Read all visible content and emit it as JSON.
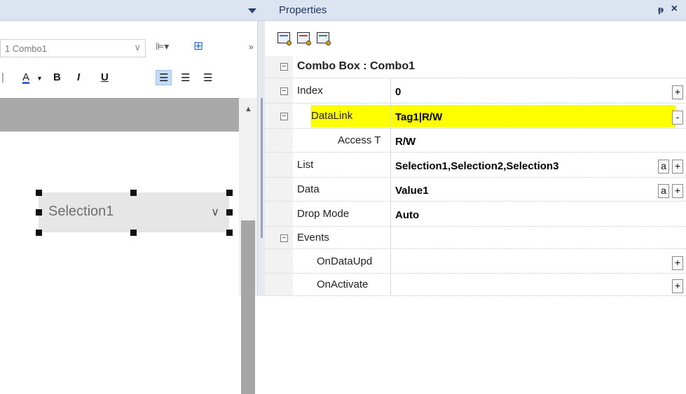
{
  "left": {
    "toolbar": {
      "object_combo_value": "1 Combo1",
      "overflow_label": "»"
    },
    "format_bar": {
      "font_color": "A",
      "bold": "B",
      "italic": "I",
      "underline": "U"
    },
    "widget": {
      "selected_text": "Selection1"
    }
  },
  "properties": {
    "title": "Properties",
    "pin_glyph": "ᵖ",
    "close_glyph": "×",
    "section_title": "Combo Box : Combo1",
    "rows": [
      {
        "name": "Index",
        "value": "0",
        "expander": "−",
        "buttons": [
          "+"
        ]
      },
      {
        "name": "DataLink",
        "value": "Tag1|R/W",
        "expander": "−",
        "buttons": [
          "-"
        ],
        "highlight": "#ffff00"
      },
      {
        "name": "Access T",
        "value": "R/W",
        "buttons": []
      },
      {
        "name": "List",
        "value": "Selection1,Selection2,Selection3",
        "buttons": [
          "a",
          "+"
        ]
      },
      {
        "name": "Data",
        "value": "Value1",
        "buttons": [
          "a",
          "+"
        ]
      },
      {
        "name": "Drop Mode",
        "value": "Auto",
        "buttons": []
      },
      {
        "name": "Events",
        "value": "",
        "expander": "−",
        "buttons": []
      },
      {
        "name": "OnDataUpd",
        "value": "",
        "buttons": [
          "+"
        ]
      },
      {
        "name": "OnActivate",
        "value": "",
        "buttons": [
          "+"
        ]
      }
    ]
  },
  "colors": {
    "header_bg": "#dce3f1",
    "highlight": "#ffff00",
    "title_color": "#1f3864"
  }
}
